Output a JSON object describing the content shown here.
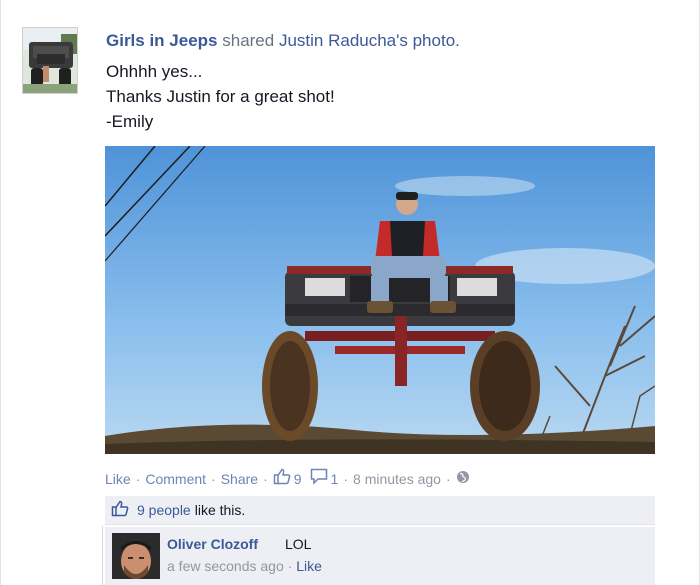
{
  "post": {
    "page_name": "Girls in Jeeps",
    "shared_word": "shared",
    "shared_source": "Justin Raducha's photo.",
    "message_lines": [
      "Ohhhh yes...",
      "Thanks Justin for a great shot!",
      "-Emily"
    ],
    "photo_icon": "jeep-photo"
  },
  "actions": {
    "like": "Like",
    "comment": "Comment",
    "share": "Share",
    "like_count": "9",
    "comment_count": "1",
    "time": "8 minutes ago",
    "like_icon": "thumbs-up-icon",
    "comment_icon": "comment-bubble-icon",
    "privacy_icon": "globe-icon"
  },
  "likes": {
    "link_text": "9 people",
    "rest_text": "like this."
  },
  "comment": {
    "author": "Oliver Clozoff",
    "text": "LOL",
    "time": "a few seconds ago",
    "like": "Like"
  },
  "colors": {
    "link": "#3b5998",
    "muted_link": "#6d84b4",
    "meta_gray": "#9197a3",
    "ufi_background": "#edeff4"
  }
}
